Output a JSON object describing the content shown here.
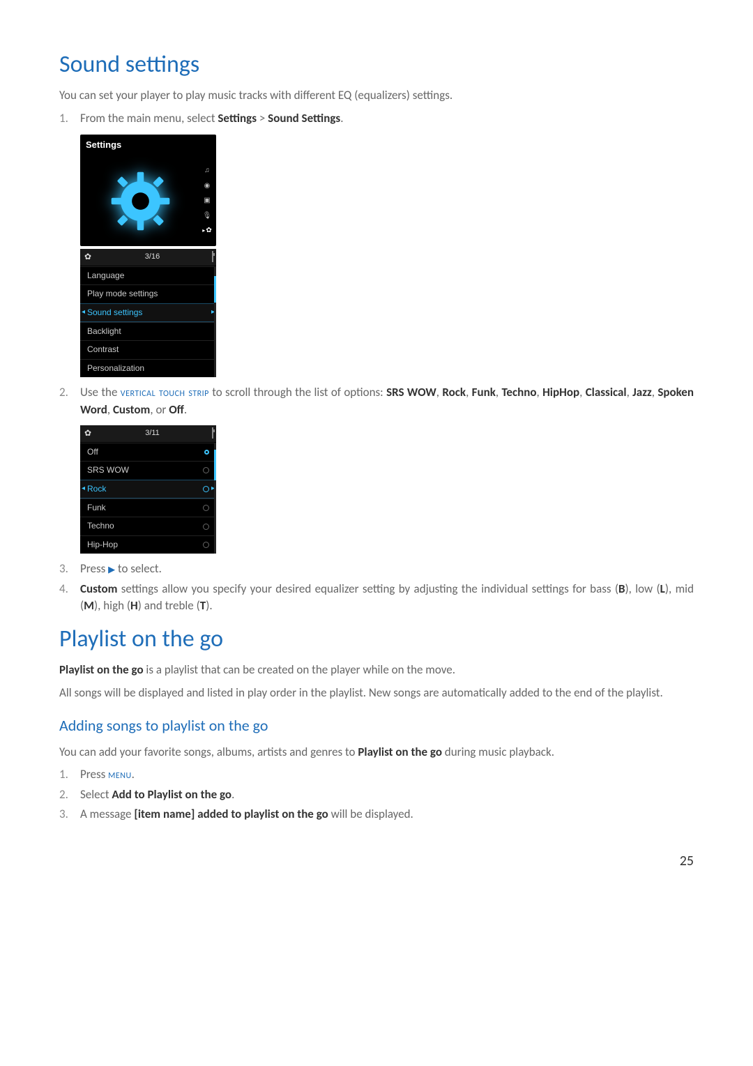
{
  "page_number": "25",
  "section1": {
    "heading": "Sound settings",
    "intro": "You can set your player to play music tracks with different EQ (equalizers) settings.",
    "step1_num": "1.",
    "step1_a": "From the main menu, select ",
    "step1_b": "Settings",
    "step1_c": " > ",
    "step1_d": "Sound Settings",
    "step1_e": ".",
    "step2_num": "2.",
    "step2_a": "Use the ",
    "step2_b": "vertical touch strip",
    "step2_c": " to scroll through the list of options: ",
    "step2_d": "SRS WOW",
    "step2_e": ", ",
    "step2_f": "Rock",
    "step2_g": ", ",
    "step2_h": "Funk",
    "step2_i": ", ",
    "step2_j": "Techno",
    "step2_k": ", ",
    "step2_l": "HipHop",
    "step2_m": ", ",
    "step2_n": "Classical",
    "step2_o": ", ",
    "step2_p": "Jazz",
    "step2_q": ", ",
    "step2_r": "Spoken Word",
    "step2_s": ", ",
    "step2_t": "Custom",
    "step2_u": ", or ",
    "step2_v": "Off",
    "step2_w": ".",
    "step3_num": "3.",
    "step3_a": "Press ",
    "step3_b": " to select.",
    "step4_num": "4.",
    "step4_a": "Custom",
    "step4_b": " settings allow you specify your desired equalizer setting by adjusting the individual settings for bass (",
    "step4_c": "B",
    "step4_d": "), low (",
    "step4_e": "L",
    "step4_f": "), mid (",
    "step4_g": "M",
    "step4_h": "), high (",
    "step4_i": "H",
    "step4_j": ") and treble (",
    "step4_k": "T",
    "step4_l": ")."
  },
  "dev1": {
    "title": "Settings",
    "count": "3/16",
    "items": [
      "Language",
      "Play mode settings",
      "Sound settings",
      "Backlight",
      "Contrast",
      "Personalization"
    ],
    "selected_index": 2
  },
  "dev2": {
    "count": "3/11",
    "items": [
      "Off",
      "SRS WOW",
      "Rock",
      "Funk",
      "Techno",
      "Hip-Hop"
    ],
    "selected_index": 2
  },
  "section2": {
    "heading": "Playlist on the go",
    "p1_a": "Playlist on the go",
    "p1_b": " is a playlist that can be created on the player while on the move.",
    "p2": "All songs will be displayed and listed in play order in the playlist. New songs are automatically added to the end of the playlist.",
    "subheading": "Adding songs to playlist on the go",
    "p3_a": "You can add your favorite songs, albums, artists and genres to ",
    "p3_b": "Playlist on the go",
    "p3_c": " during music playback.",
    "s1_num": "1.",
    "s1_a": "Press ",
    "s1_b": "menu",
    "s1_c": ".",
    "s2_num": "2.",
    "s2_a": "Select ",
    "s2_b": "Add to Playlist on the go",
    "s2_c": ".",
    "s3_num": "3.",
    "s3_a": "A message ",
    "s3_b": "[item name] added to playlist on the go",
    "s3_c": " will be displayed."
  }
}
